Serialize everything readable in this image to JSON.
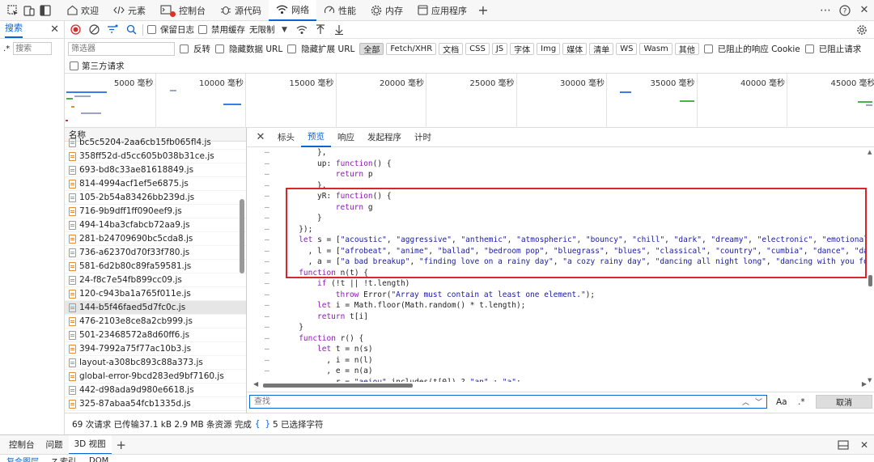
{
  "top_tabs": [
    {
      "label": "欢迎",
      "icon": "home-icon"
    },
    {
      "label": "元素",
      "icon": "code-brackets-icon"
    },
    {
      "label": "控制台",
      "icon": "console-icon"
    },
    {
      "label": "源代码",
      "icon": "bug-icon"
    },
    {
      "label": "网络",
      "icon": "wifi-icon"
    },
    {
      "label": "性能",
      "icon": "gauge-icon"
    },
    {
      "label": "内存",
      "icon": "memory-icon"
    },
    {
      "label": "应用程序",
      "icon": "window-icon"
    }
  ],
  "search_panel": {
    "tab": "搜索",
    "placeholder": "搜索"
  },
  "toolbar": {
    "preserve_log": "保留日志",
    "disable_cache": "禁用缓存",
    "throttle": "无限制"
  },
  "filters": {
    "placeholder": "筛选器",
    "invert": "反转",
    "hide_data_urls": "隐藏数据 URL",
    "hide_ext_urls": "隐藏扩展 URL",
    "types": [
      "全部",
      "Fetch/XHR",
      "文档",
      "CSS",
      "JS",
      "字体",
      "Img",
      "媒体",
      "清单",
      "WS",
      "Wasm",
      "其他"
    ],
    "blocked_cookies": "已阻止的响应 Cookie",
    "blocked_requests": "已阻止请求",
    "third_party": "第三方请求"
  },
  "timeline": {
    "ticks": [
      "5000 毫秒",
      "10000 毫秒",
      "15000 毫秒",
      "20000 毫秒",
      "25000 毫秒",
      "30000 毫秒",
      "35000 毫秒",
      "40000 毫秒",
      "45000 毫秒"
    ]
  },
  "request_list": {
    "header": "名称",
    "items": [
      "bc5c5204-2aa6cb15fb065fl4.js",
      "358ff52d-d5cc605b038b31ce.js",
      "693-bd8c33ae81618849.js",
      "814-4994acf1ef5e6875.js",
      "105-2b54a83426bb239d.js",
      "716-9b9dff1ff090eef9.js",
      "494-14ba3cfabcb72aa9.js",
      "281-b24709690bc5cda8.js",
      "736-a62370d70f33f780.js",
      "581-6d2b80c89fa59581.js",
      "24-f8c7e54fb899cc09.js",
      "120-c943ba1a765f011e.js",
      "144-b5f46faed5d7fc0c.js",
      "476-2103e8ce8a2cb999.js",
      "501-23468572a8d60ff6.js",
      "394-7992a75f77ac10b3.js",
      "layout-a308bc893c88a373.js",
      "global-error-9bcd283ed9bf7160.js",
      "442-d98ada9d980e6618.js",
      "325-87abaa54fcb1335d.js"
    ],
    "selected_index": 12
  },
  "preview_tabs": [
    "标头",
    "预览",
    "响应",
    "发起程序",
    "计时"
  ],
  "code_lines": [
    {
      "indent": 10,
      "text": "},"
    },
    {
      "indent": 10,
      "text": "up: function() {"
    },
    {
      "indent": 14,
      "text": "return p"
    },
    {
      "indent": 10,
      "text": "},"
    },
    {
      "indent": 10,
      "text": "yR: function() {"
    },
    {
      "indent": 14,
      "text": "return g"
    },
    {
      "indent": 10,
      "text": "}"
    },
    {
      "indent": 6,
      "text": "});"
    },
    {
      "indent": 6,
      "text": "let s = [\"acoustic\", \"aggressive\", \"anthemic\", \"atmospheric\", \"bouncy\", \"chill\", \"dark\", \"dreamy\", \"electronic\", \"emotional\", \"epi"
    },
    {
      "indent": 8,
      "text": ", l = [\"afrobeat\", \"anime\", \"ballad\", \"bedroom pop\", \"bluegrass\", \"blues\", \"classical\", \"country\", \"cumbia\", \"dance\", \"dancepop\""
    },
    {
      "indent": 8,
      "text": ", a = [\"a bad breakup\", \"finding love on a rainy day\", \"a cozy rainy day\", \"dancing all night long\", \"dancing with you for the l"
    },
    {
      "indent": 6,
      "text": "function n(t) {"
    },
    {
      "indent": 10,
      "text": "if (!t || !t.length)"
    },
    {
      "indent": 14,
      "text": "throw Error(\"Array must contain at least one element.\");"
    },
    {
      "indent": 10,
      "text": "let i = Math.floor(Math.random() * t.length);"
    },
    {
      "indent": 10,
      "text": "return t[i]"
    },
    {
      "indent": 6,
      "text": "}"
    },
    {
      "indent": 6,
      "text": "function r() {"
    },
    {
      "indent": 10,
      "text": "let t = n(s)"
    },
    {
      "indent": 12,
      "text": ", i = n(l)"
    },
    {
      "indent": 12,
      "text": ", e = n(a)"
    },
    {
      "indent": 12,
      "text": ", r = \"aeiou\".includes(t[0]) ? \"an\" : \"a\";"
    }
  ],
  "find_bar": {
    "placeholder": "查找",
    "match_case": "Aa",
    "regex": ".*",
    "cancel": "取消"
  },
  "status": {
    "summary": "69 次请求  已传输37.1 kB  2.9 MB 条资源  完成:",
    "selection": "5 已选择字符",
    "braces": "{ }"
  },
  "drawer_tabs": [
    "控制台",
    "问题",
    "3D 视图"
  ],
  "drawer2_tabs": [
    "复合图层",
    "Z 索引",
    "DOM"
  ],
  "colors": {
    "accent": "#0a64d6",
    "highlight_box": "#d9262b",
    "record": "#d32f2f"
  }
}
